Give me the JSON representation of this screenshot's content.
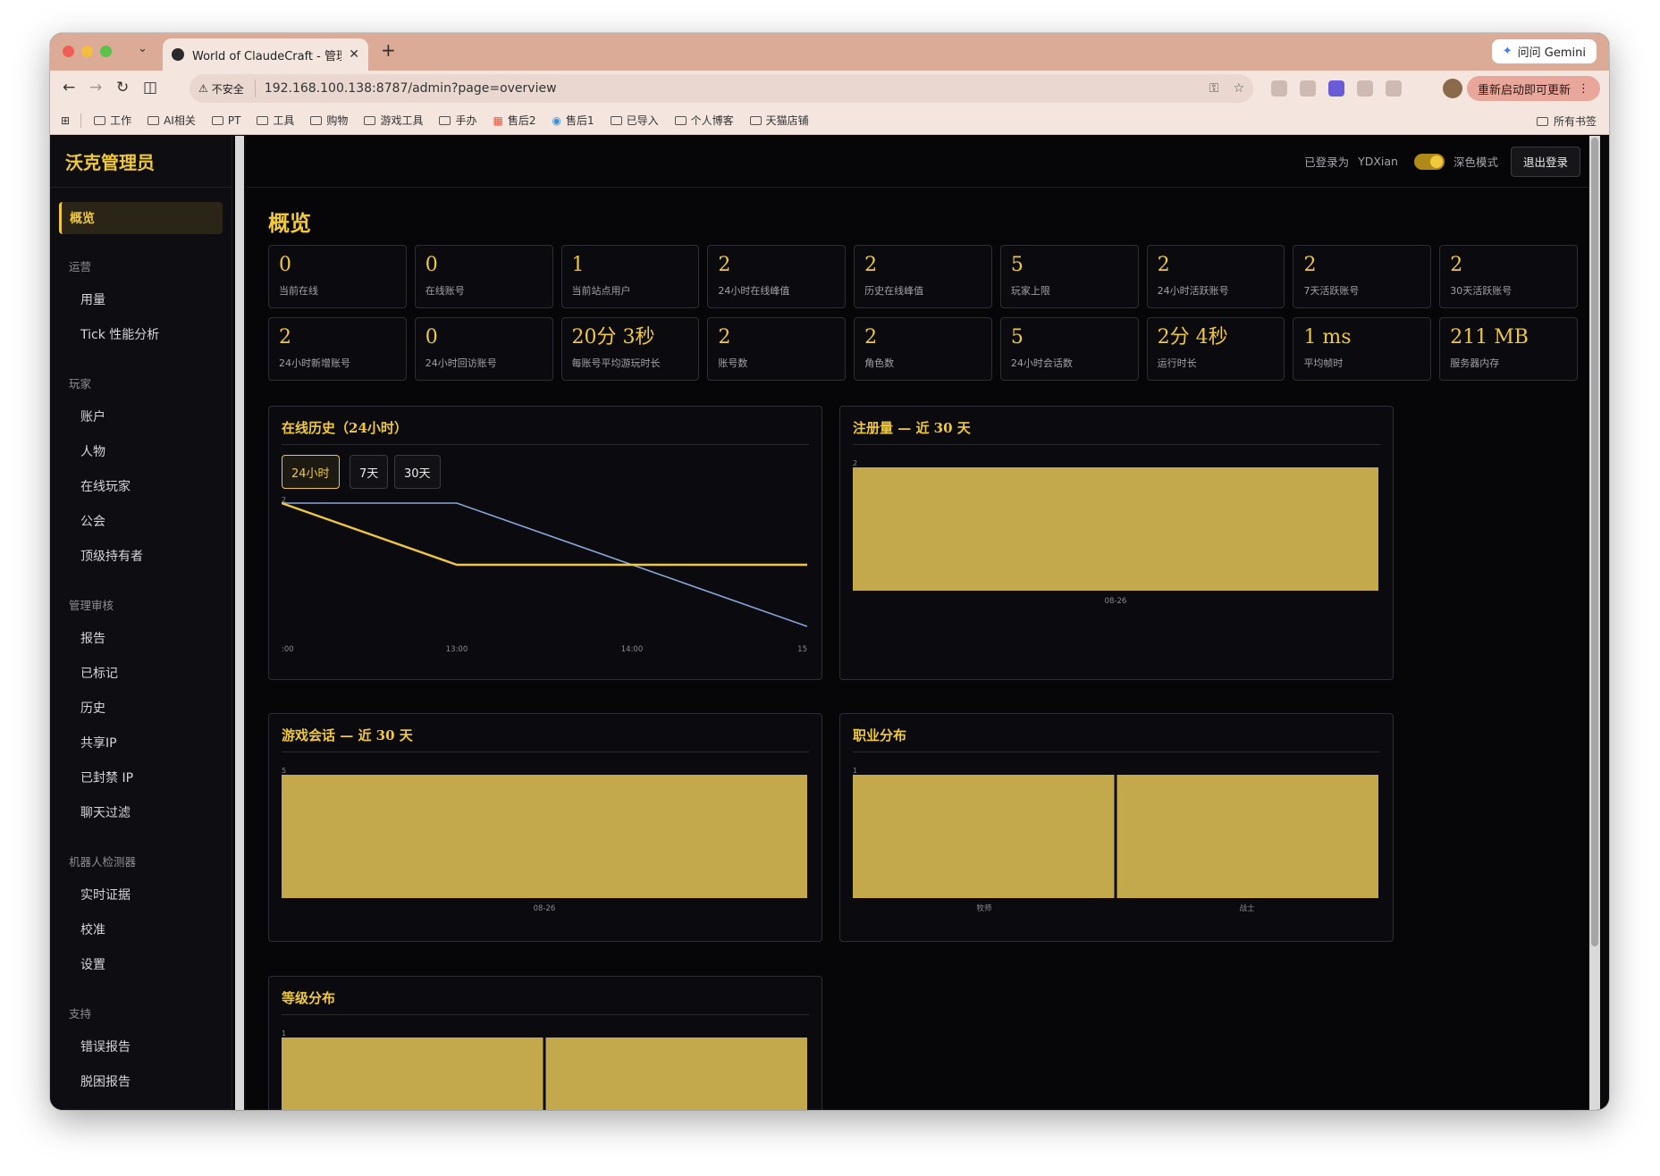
{
  "browser": {
    "tab_title": "World of ClaudeCraft - 管理后",
    "new_tab": "+",
    "gemini": "问问 Gemini",
    "insecure": "不安全",
    "url": "192.168.100.138:8787/admin?page=overview",
    "restart": "重新启动即可更新",
    "bookmarks": [
      "工作",
      "AI相关",
      "PT",
      "工具",
      "购物",
      "游戏工具",
      "手办",
      "售后2",
      "售后1",
      "已导入",
      "个人博客",
      "天猫店铺"
    ],
    "all_bookmarks": "所有书签"
  },
  "sidebar": {
    "brand": "沃克管理员",
    "active": "概览",
    "sections": [
      {
        "title": "运营",
        "items": [
          "用量",
          "Tick 性能分析"
        ]
      },
      {
        "title": "玩家",
        "items": [
          "账户",
          "人物",
          "在线玩家",
          "公会",
          "顶级持有者"
        ]
      },
      {
        "title": "管理审核",
        "items": [
          "报告",
          "已标记",
          "历史",
          "共享IP",
          "已封禁 IP",
          "聊天过滤"
        ]
      },
      {
        "title": "机器人检测器",
        "items": [
          "实时证据",
          "校准",
          "设置"
        ]
      },
      {
        "title": "支持",
        "items": [
          "错误报告",
          "脱困报告"
        ]
      }
    ]
  },
  "topbar": {
    "logged_in_as": "已登录为",
    "username": "YDXian",
    "dark_mode": "深色模式",
    "logout": "退出登录"
  },
  "page": {
    "title": "概览"
  },
  "stats": [
    {
      "value": "0",
      "label": "当前在线"
    },
    {
      "value": "0",
      "label": "在线账号"
    },
    {
      "value": "1",
      "label": "当前站点用户"
    },
    {
      "value": "2",
      "label": "24小时在线峰值"
    },
    {
      "value": "2",
      "label": "历史在线峰值"
    },
    {
      "value": "5",
      "label": "玩家上限"
    },
    {
      "value": "2",
      "label": "24小时活跃账号"
    },
    {
      "value": "2",
      "label": "7天活跃账号"
    },
    {
      "value": "2",
      "label": "30天活跃账号"
    },
    {
      "value": "2",
      "label": "24小时新增账号"
    },
    {
      "value": "0",
      "label": "24小时回访账号"
    },
    {
      "value": "20分 3秒",
      "label": "每账号平均游玩时长"
    },
    {
      "value": "2",
      "label": "账号数"
    },
    {
      "value": "2",
      "label": "角色数"
    },
    {
      "value": "5",
      "label": "24小时会话数"
    },
    {
      "value": "2分 4秒",
      "label": "运行时长"
    },
    {
      "value": "1 ms",
      "label": "平均帧时"
    },
    {
      "value": "211 MB",
      "label": "服务器内存"
    }
  ],
  "panels": {
    "online_history": {
      "title": "在线历史（24小时）",
      "ranges": [
        "24小时",
        "7天",
        "30天"
      ],
      "active_range": "24小时"
    },
    "registrations": {
      "title": "注册量 — 近 30 天"
    },
    "sessions": {
      "title": "游戏会话 — 近 30 天"
    },
    "classes": {
      "title": "职业分布"
    },
    "levels": {
      "title": "等级分布"
    }
  },
  "colors": {
    "accent": "#f0c93a",
    "bar": "#c3a84c",
    "line_secondary": "#8aa6d8"
  },
  "chart_data": [
    {
      "id": "online_history",
      "type": "line",
      "x_ticks": [
        ":00",
        "13:00",
        "14:00",
        "15"
      ],
      "y_tick_top": "2",
      "series": [
        {
          "values": [
            2,
            1,
            1,
            1
          ],
          "color": "#f0c93a"
        },
        {
          "values": [
            2,
            2,
            1,
            0
          ],
          "color": "#8aa6d8"
        }
      ],
      "ylim": [
        0,
        2
      ]
    },
    {
      "id": "registrations",
      "type": "bar",
      "categories": [
        "08-26"
      ],
      "values": [
        2
      ],
      "ylim": [
        0,
        2
      ],
      "y_tick_top": "2"
    },
    {
      "id": "sessions",
      "type": "bar",
      "categories": [
        "08-26"
      ],
      "values": [
        5
      ],
      "ylim": [
        0,
        5
      ],
      "y_tick_top": "5"
    },
    {
      "id": "classes",
      "type": "bar",
      "categories": [
        "牧师",
        "战士"
      ],
      "values": [
        1,
        1
      ],
      "ylim": [
        0,
        1
      ],
      "y_tick_top": "1"
    },
    {
      "id": "levels",
      "type": "bar",
      "categories": [
        "",
        ""
      ],
      "values": [
        1,
        1
      ],
      "ylim": [
        0,
        1
      ],
      "y_tick_top": "1"
    }
  ]
}
